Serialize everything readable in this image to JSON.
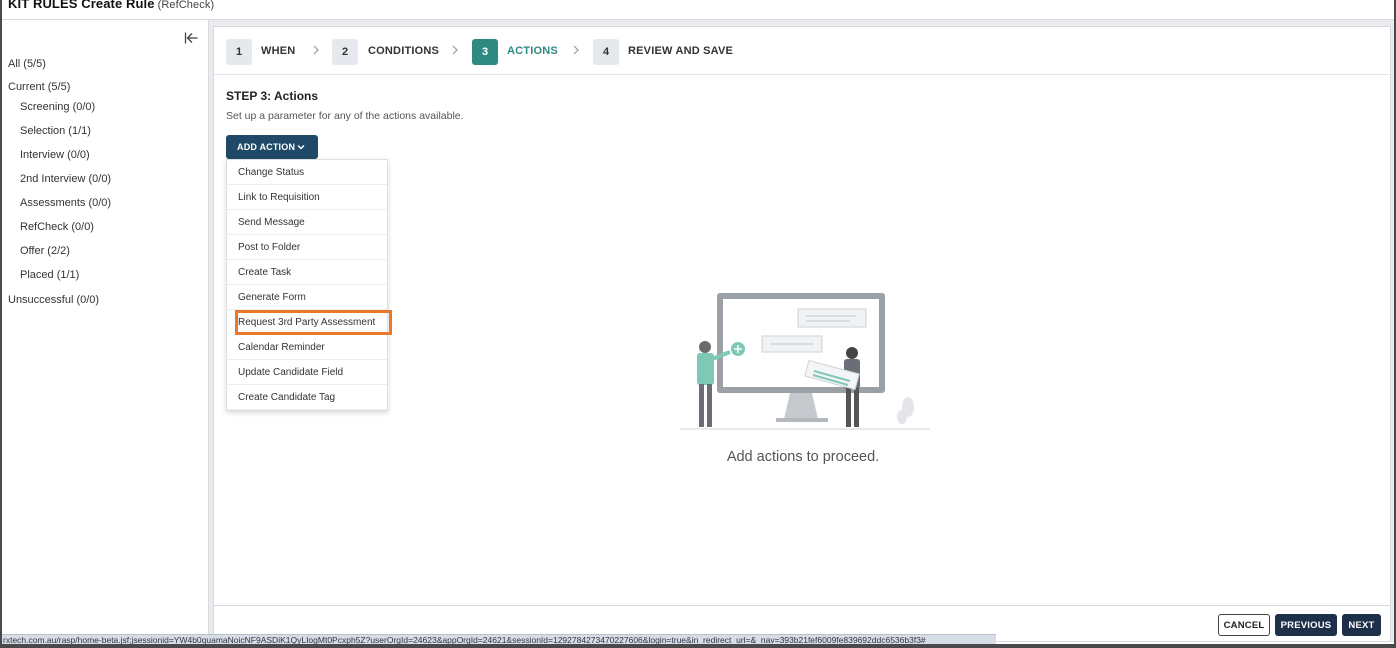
{
  "window": {
    "title": "KIT RULES Create Rule",
    "subtitle": "(RefCheck)"
  },
  "sidebar": {
    "items": [
      {
        "label": "All (5/5)",
        "level": 0
      },
      {
        "label": "Current (5/5)",
        "level": 0
      },
      {
        "label": "Screening (0/0)",
        "level": 1
      },
      {
        "label": "Selection (1/1)",
        "level": 1
      },
      {
        "label": "Interview (0/0)",
        "level": 1
      },
      {
        "label": "2nd Interview (0/0)",
        "level": 1
      },
      {
        "label": "Assessments (0/0)",
        "level": 1
      },
      {
        "label": "RefCheck (0/0)",
        "level": 1
      },
      {
        "label": "Offer (2/2)",
        "level": 1
      },
      {
        "label": "Placed (1/1)",
        "level": 1
      },
      {
        "label": "Unsuccessful (0/0)",
        "level": 0
      }
    ]
  },
  "stepper": {
    "steps": [
      {
        "number": "1",
        "label": "WHEN",
        "active": false
      },
      {
        "number": "2",
        "label": "CONDITIONS",
        "active": false
      },
      {
        "number": "3",
        "label": "ACTIONS",
        "active": true
      },
      {
        "number": "4",
        "label": "REVIEW AND SAVE",
        "active": false
      }
    ]
  },
  "content": {
    "step_title": "STEP 3: Actions",
    "step_description": "Set up a parameter for any of the actions available.",
    "add_action_label": "ADD ACTION",
    "empty_message": "Add actions to proceed."
  },
  "dropdown": {
    "items": [
      "Change Status",
      "Link to Requisition",
      "Send Message",
      "Post to Folder",
      "Create Task",
      "Generate Form",
      "Request 3rd Party Assessment",
      "Calendar Reminder",
      "Update Candidate Field",
      "Create Candidate Tag"
    ],
    "highlighted_item": "Request 3rd Party Assessment"
  },
  "footer": {
    "cancel_label": "CANCEL",
    "previous_label": "PREVIOUS",
    "next_label": "NEXT"
  },
  "status_bar": {
    "url": "rxtech.com.au/rasp/home-beta.jsf;jsessionid=YW4b0quamaNoicNF9ASDiK1QyLIogMt0Pcxph5Z?userOrgId=24623&appOrgId=24621&sessionId=1292784273470227606&login=true&in_redirect_url=&_nav=393b21fef6009fe839692ddc6536b3f3#"
  },
  "colors": {
    "accent_teal": "#2e8a80",
    "primary_navy": "#1f4966",
    "button_dark": "#1e2f4a",
    "highlight_orange": "#e8782a"
  }
}
